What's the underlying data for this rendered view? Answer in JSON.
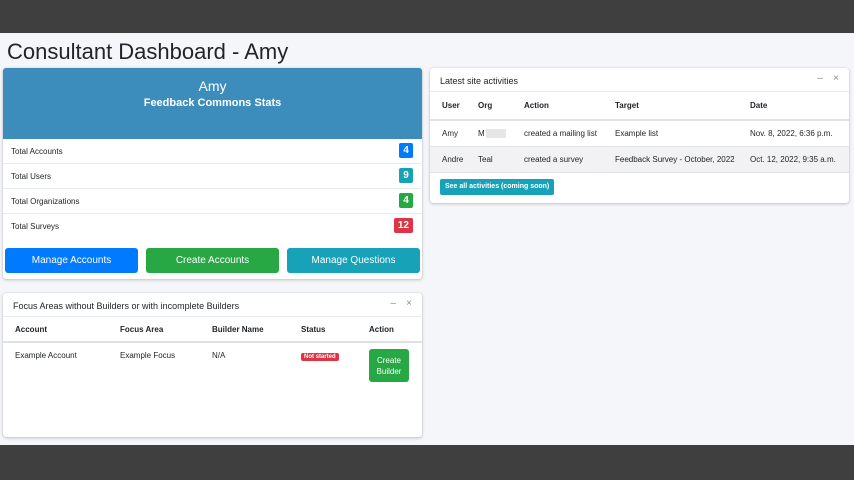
{
  "page": {
    "title": "Consultant Dashboard - Amy"
  },
  "stats": {
    "name": "Amy",
    "subtitle": "Feedback Commons Stats",
    "rows": [
      {
        "label": "Total Accounts",
        "value": "4",
        "color": "#007bff"
      },
      {
        "label": "Total Users",
        "value": "9",
        "color": "#17a2b8"
      },
      {
        "label": "Total Organizations",
        "value": "4",
        "color": "#28a745"
      },
      {
        "label": "Total Surveys",
        "value": "12",
        "color": "#dc3545"
      }
    ],
    "buttons": {
      "manage_accounts": "Manage Accounts",
      "create_accounts": "Create Accounts",
      "manage_questions": "Manage Questions"
    }
  },
  "focus": {
    "title": "Focus Areas without Builders or with incomplete Builders",
    "columns": [
      "Account",
      "Focus Area",
      "Builder Name",
      "Status",
      "Action"
    ],
    "rows": [
      {
        "account": "Example Account",
        "focus_area": "Example Focus",
        "builder_name": "N/A",
        "status": "Not started",
        "action_line1": "Create",
        "action_line2": "Builder"
      }
    ]
  },
  "activities": {
    "title": "Latest site activities",
    "columns": [
      "User",
      "Org",
      "Action",
      "Target",
      "Date"
    ],
    "rows": [
      {
        "user": "Amy",
        "org": "M",
        "action": "created a mailing list",
        "target": "Example list",
        "date": "Nov. 8, 2022, 6:36 p.m."
      },
      {
        "user": "Andre",
        "org": "Teal",
        "action": "created a survey",
        "target": "Feedback Survey - October, 2022",
        "date": "Oct. 12, 2022, 9:35 a.m."
      }
    ],
    "see_all": "See all activities (coming soon)"
  },
  "icons": {
    "minimize": "minus-icon",
    "close": "close-icon"
  },
  "colors": {
    "header_blue": "#3c8dbc",
    "primary": "#007bff",
    "success": "#28a745",
    "info": "#17a2b8",
    "danger": "#dc3545"
  }
}
